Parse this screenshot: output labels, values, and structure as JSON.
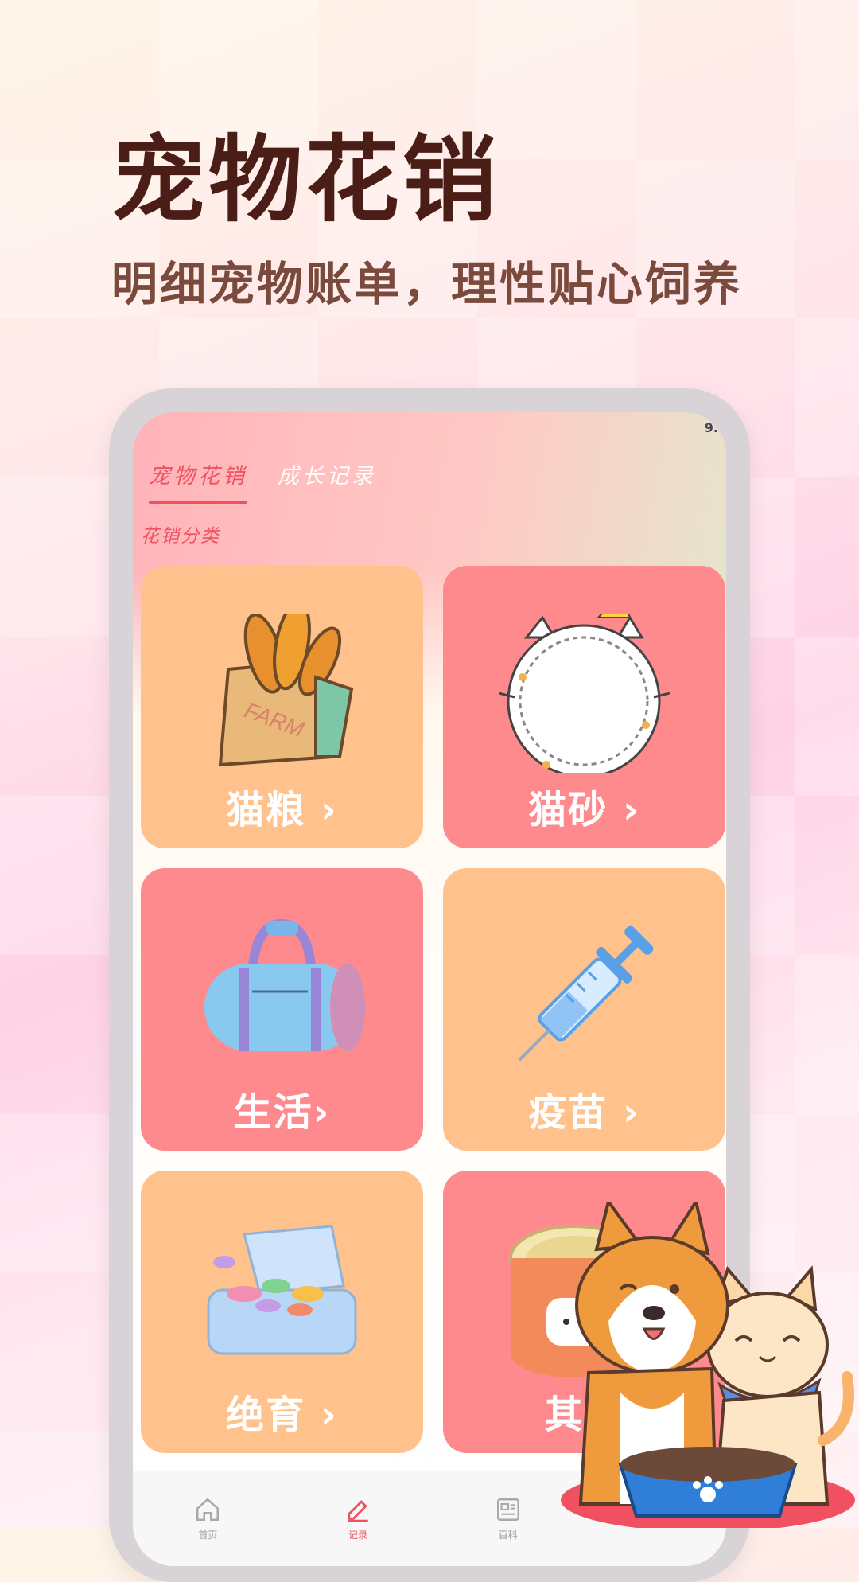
{
  "hero": {
    "title": "宠物花销",
    "subtitle": "明细宠物账单，理性贴心饲养"
  },
  "status": {
    "time": "9."
  },
  "tabs": [
    {
      "label": "宠物花销",
      "active": true
    },
    {
      "label": "成长记录",
      "active": false
    }
  ],
  "section_label": "花销分类",
  "categories": [
    {
      "label": "猫粮 ›",
      "icon": "bread-bag-icon",
      "color": "#ffc28d"
    },
    {
      "label": "猫砂 ›",
      "icon": "cat-plate-icon",
      "color": "#ff8a8e"
    },
    {
      "label": "生活›",
      "icon": "duffel-bag-icon",
      "color": "#ff8a8e"
    },
    {
      "label": "疫苗 ›",
      "icon": "syringe-icon",
      "color": "#ffc28d"
    },
    {
      "label": "绝育 ›",
      "icon": "pill-box-icon",
      "color": "#ffc28d"
    },
    {
      "label": "其它",
      "icon": "pet-food-can-icon",
      "color": "#ff8a8e"
    }
  ],
  "bottom_nav": [
    {
      "label": "首页",
      "icon": "home-icon",
      "active": false
    },
    {
      "label": "记录",
      "icon": "pencil-icon",
      "active": true
    },
    {
      "label": "百科",
      "icon": "news-icon",
      "active": false
    }
  ],
  "colors": {
    "accent": "#f0505f",
    "card_orange": "#ffc28d",
    "card_pink": "#ff8a8e"
  }
}
